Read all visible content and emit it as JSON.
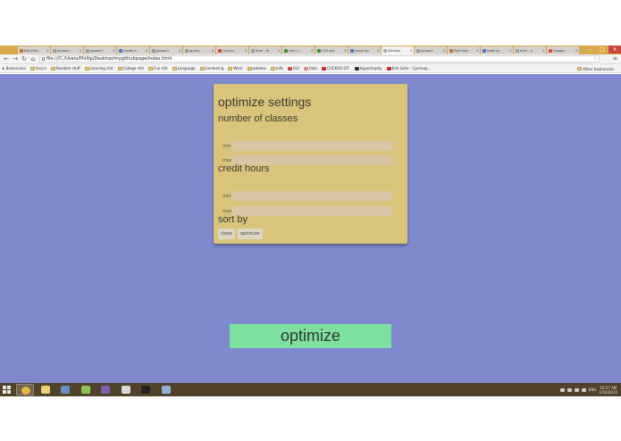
{
  "browser": {
    "tabs": [
      {
        "label": "Edit Fold",
        "color": "#cc6d2b"
      },
      {
        "label": "javascri",
        "color": "#999999"
      },
      {
        "label": "javascri",
        "color": "#999999"
      },
      {
        "label": "create a",
        "color": "#4a76c7"
      },
      {
        "label": "javascri",
        "color": "#999999"
      },
      {
        "label": "jquery -",
        "color": "#999999"
      },
      {
        "label": "Course -",
        "color": "#d94a2b"
      },
      {
        "label": "html - le",
        "color": "#999999"
      },
      {
        "label": "Can I u",
        "color": "#3a8f3a"
      },
      {
        "label": "CSS pro",
        "color": "#3a8f3a"
      },
      {
        "label": "move op",
        "color": "#4a76c7"
      },
      {
        "label": "Schedul",
        "color": "#aaaaaa",
        "active": true
      },
      {
        "label": "javascri",
        "color": "#999999"
      },
      {
        "label": "Edit Fold",
        "color": "#cc6d2b"
      },
      {
        "label": "table sc",
        "color": "#4a76c7"
      },
      {
        "label": "html - h",
        "color": "#999999"
      },
      {
        "label": "Google",
        "color": "#d94a2b"
      }
    ],
    "url": "file:///C:/Users/Phillip/Desktop/mygithubpage/index.html",
    "bookmarks": [
      {
        "label": "Bookmarks",
        "kind": "star"
      },
      {
        "label": "Social",
        "kind": "folder"
      },
      {
        "label": "Random stuff",
        "kind": "folder"
      },
      {
        "label": "Learning shit",
        "kind": "folder"
      },
      {
        "label": "College shit",
        "kind": "folder"
      },
      {
        "label": "Fun shit",
        "kind": "folder"
      },
      {
        "label": "Language",
        "kind": "folder"
      },
      {
        "label": "Gardening",
        "kind": "folder"
      },
      {
        "label": "Work",
        "kind": "folder"
      },
      {
        "label": "webdev",
        "kind": "folder"
      },
      {
        "label": "bills",
        "kind": "folder"
      },
      {
        "label": "ISU",
        "kind": "flag"
      },
      {
        "label": "Oats",
        "kind": "plain"
      },
      {
        "label": "CUCKOO OF!",
        "kind": "youtube"
      },
      {
        "label": "Hypertrophy",
        "kind": "dark"
      },
      {
        "label": "Erik Satie - Gymnop...",
        "kind": "youtube"
      }
    ],
    "other_bookmarks": "Other bookmarks"
  },
  "settings": {
    "title": "optimize settings",
    "classes_title": "number of classes",
    "credit_title": "credit hours",
    "min_label": "min",
    "max_label": "max",
    "sort_title": "sort by",
    "sort_close": "close",
    "sort_optimize": "optimize"
  },
  "main_button": "optimize",
  "taskbar": {
    "apps": [
      {
        "name": "chrome",
        "color": "#e8b83a"
      },
      {
        "name": "explorer",
        "color": "#e9cf7a"
      },
      {
        "name": "task-manager",
        "color": "#6a8fc7"
      },
      {
        "name": "android",
        "color": "#8fc45a"
      },
      {
        "name": "media",
        "color": "#7d5fb0"
      },
      {
        "name": "terminal-window",
        "color": "#d8d8d8"
      },
      {
        "name": "cmd",
        "color": "#222222"
      },
      {
        "name": "notepad",
        "color": "#8fb0d8"
      }
    ],
    "lang": "ENG",
    "time": "10:57 AM",
    "date": "1/16/2015"
  },
  "colors": {
    "page_bg": "#7f89cd",
    "panel_bg": "#d8c47a",
    "field_bg": "#d9c6a6",
    "optimize_button": "#7ddfa0",
    "taskbar": "#51432b"
  }
}
